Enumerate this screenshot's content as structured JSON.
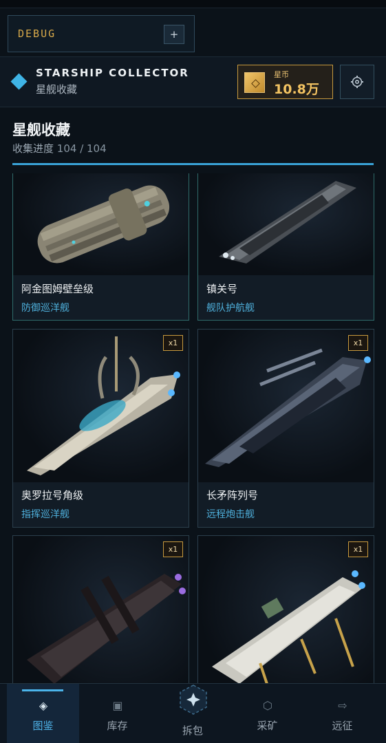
{
  "debug": {
    "label": "DEBUG",
    "plus": "+"
  },
  "header": {
    "title": "STARSHIP COLLECTOR",
    "subtitle": "星舰收藏",
    "currency_label": "星币",
    "currency_value": "10.8万"
  },
  "collection": {
    "title": "星舰收藏",
    "progress_label": "收集进度",
    "progress_value": "104 / 104",
    "progress_fraction": 1.0
  },
  "cards": [
    {
      "name": "阿金图姆壁垒级",
      "type": "防御巡洋舰",
      "badge": ""
    },
    {
      "name": "镇关号",
      "type": "舰队护航舰",
      "badge": ""
    },
    {
      "name": "奥罗拉号角级",
      "type": "指挥巡洋舰",
      "badge": "x1"
    },
    {
      "name": "长矛阵列号",
      "type": "远程炮击舰",
      "badge": "x1"
    },
    {
      "name": "",
      "type": "",
      "badge": "x1"
    },
    {
      "name": "",
      "type": "",
      "badge": "x1"
    }
  ],
  "tabs": [
    {
      "label": "图鉴",
      "icon": "codex-icon"
    },
    {
      "label": "库存",
      "icon": "inventory-icon"
    },
    {
      "label": "拆包",
      "icon": "unpack-icon"
    },
    {
      "label": "采矿",
      "icon": "mining-icon"
    },
    {
      "label": "远征",
      "icon": "expedition-icon"
    }
  ],
  "colors": {
    "accent": "#3fb4e6",
    "gold": "#c89a3e",
    "background": "#0b1219"
  }
}
